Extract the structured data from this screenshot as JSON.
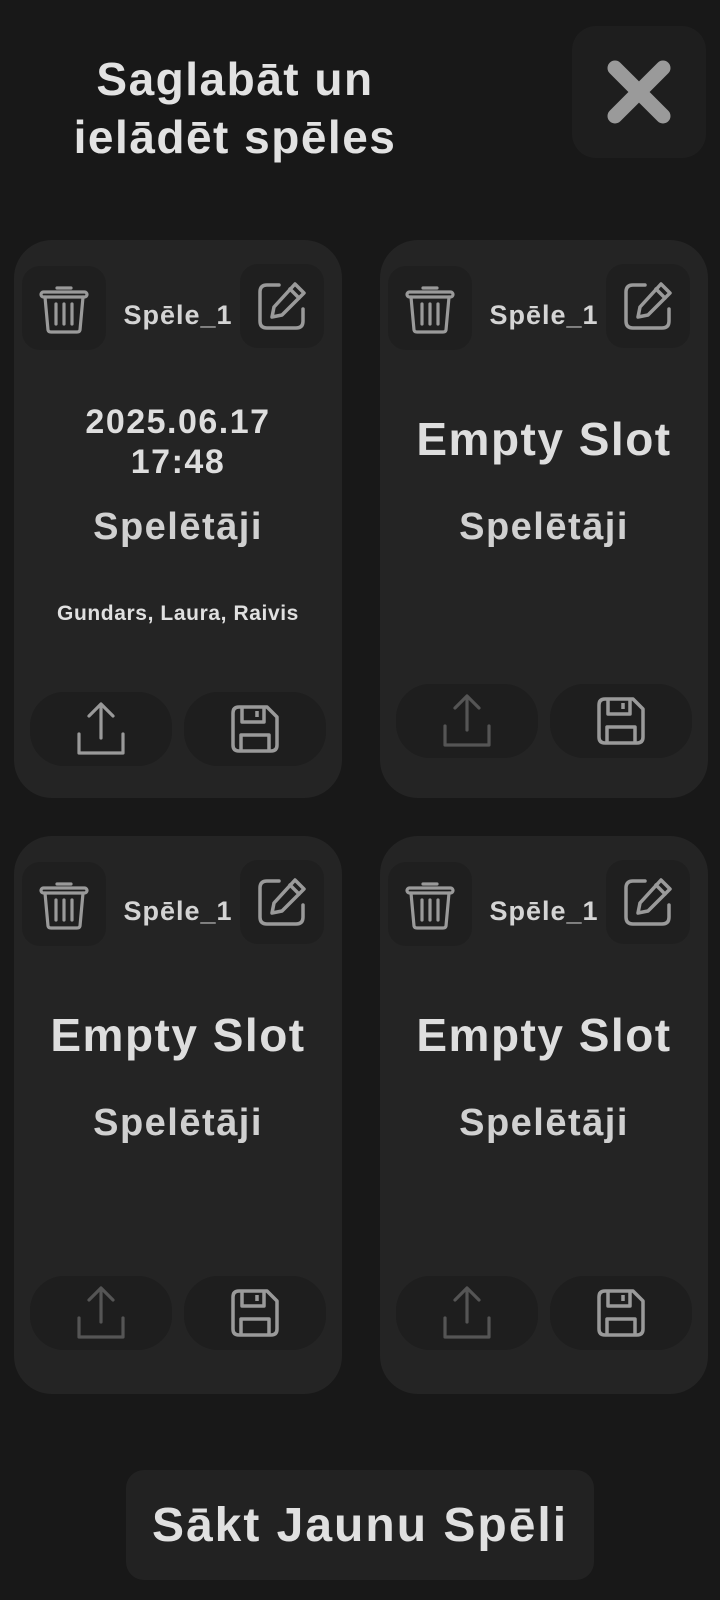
{
  "header": {
    "title_line1": "Saglabāt un",
    "title_line2": "ielādēt spēles"
  },
  "slots": [
    {
      "name": "Spēle_1",
      "date": "2025.06.17",
      "time": "17:48",
      "empty_label": "",
      "players_label": "Spelētāji",
      "players": "Gundars, Laura, Raivis",
      "upload_enabled": true
    },
    {
      "name": "Spēle_1",
      "date": "",
      "time": "",
      "empty_label": "Empty Slot",
      "players_label": "Spelētāji",
      "players": "",
      "upload_enabled": false
    },
    {
      "name": "Spēle_1",
      "date": "",
      "time": "",
      "empty_label": "Empty Slot",
      "players_label": "Spelētāji",
      "players": "",
      "upload_enabled": false
    },
    {
      "name": "Spēle_1",
      "date": "",
      "time": "",
      "empty_label": "Empty Slot",
      "players_label": "Spelētāji",
      "players": "",
      "upload_enabled": false
    }
  ],
  "footer": {
    "new_game_label": "Sākt Jaunu Spēli"
  },
  "icons": {
    "close": "close-icon",
    "delete": "trash-icon",
    "edit": "edit-icon",
    "upload": "upload-icon",
    "save": "save-icon"
  },
  "colors": {
    "background": "#181818",
    "card": "#242424",
    "button": "#1e1e1e",
    "text": "#dcdcdc",
    "icon": "#9a9a9a",
    "icon_disabled": "#555555"
  }
}
